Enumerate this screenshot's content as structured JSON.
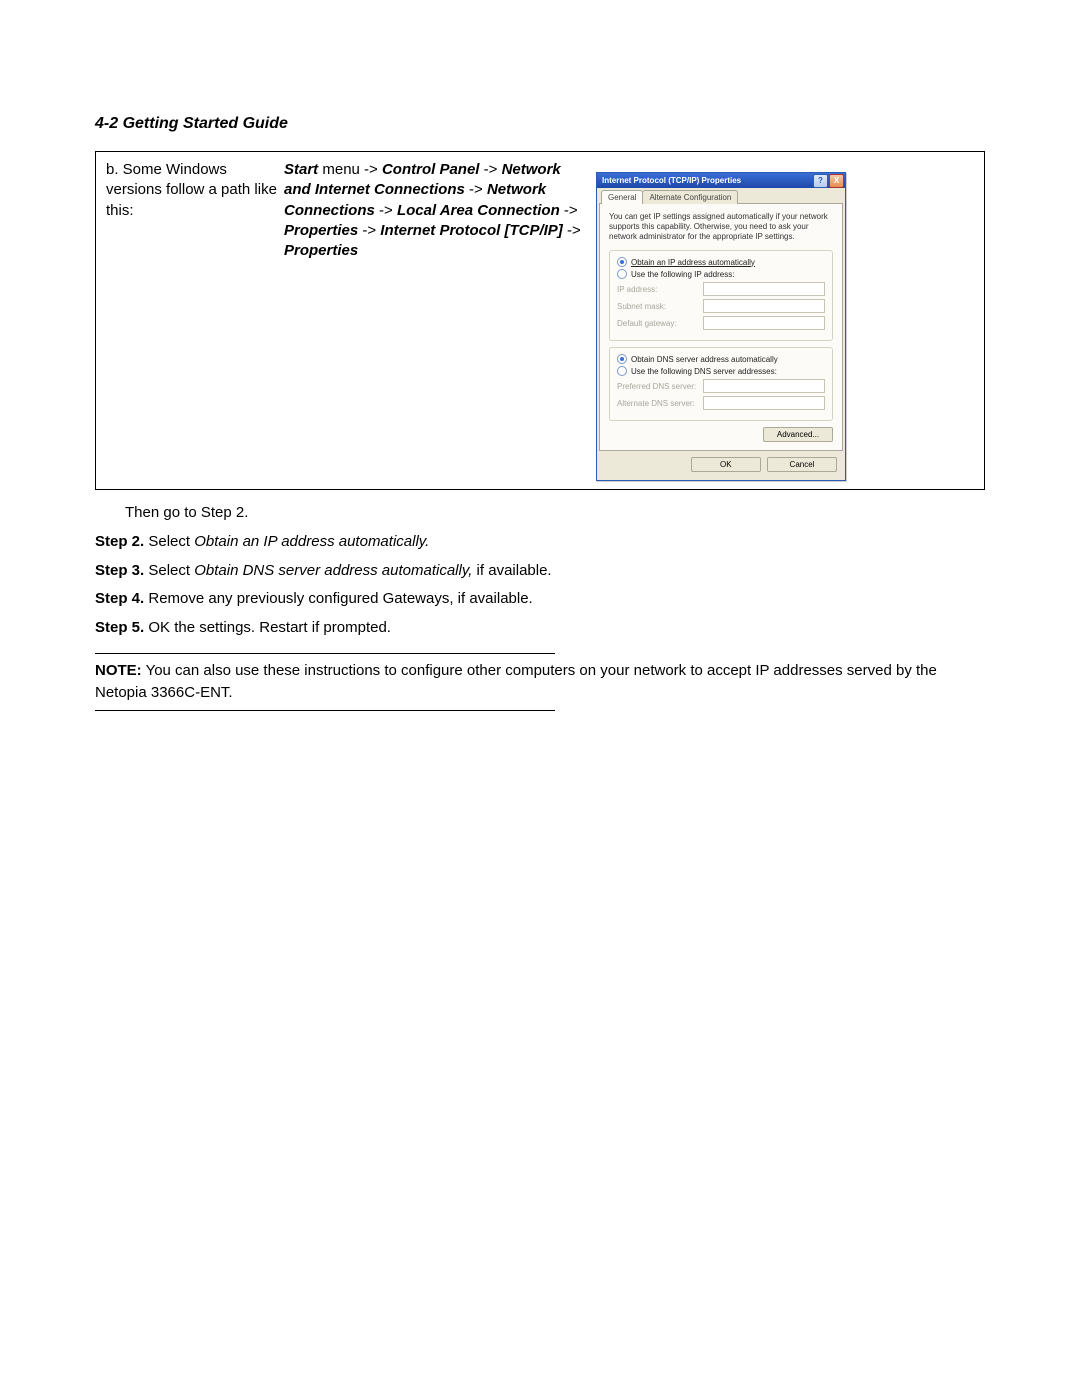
{
  "header": "4-2  Getting Started Guide",
  "box": {
    "left": "b. Some Windows versions follow a path like this:",
    "mid": {
      "p1a": "Start",
      "p1b": " menu -> ",
      "p1c": "Control Panel",
      "p1d": " -> ",
      "p1e": "Network and Internet Connections",
      "p1f": " -> ",
      "p1g": "Network Connections",
      "p1h": " -> ",
      "p1i": "Local Area Connection",
      "p1j": " -> ",
      "p1k": "Properties",
      "p1l": " -> ",
      "p1m": "Internet Protocol [TCP/IP]",
      "p1n": " -> ",
      "p1o": "Properties"
    }
  },
  "dialog": {
    "title": "Internet Protocol (TCP/IP) Properties",
    "help": "?",
    "close": "X",
    "tab_general": "General",
    "tab_alt": "Alternate Configuration",
    "hint": "You can get IP settings assigned automatically if your network supports this capability. Otherwise, you need to ask your network administrator for the appropriate IP settings.",
    "r_obtain_ip": "Obtain an IP address automatically",
    "r_use_ip": "Use the following IP address:",
    "lbl_ip": "IP address:",
    "lbl_subnet": "Subnet mask:",
    "lbl_gw": "Default gateway:",
    "r_obtain_dns": "Obtain DNS server address automatically",
    "r_use_dns": "Use the following DNS server addresses:",
    "lbl_pdns": "Preferred DNS server:",
    "lbl_adns": "Alternate DNS server:",
    "btn_adv": "Advanced...",
    "btn_ok": "OK",
    "btn_cancel": "Cancel"
  },
  "body": {
    "then": "Then go to Step 2.",
    "s2a": "Step 2.",
    "s2b": " Select ",
    "s2c": "Obtain an IP address automatically.",
    "s3a": "Step 3.",
    "s3b": " Select ",
    "s3c": "Obtain DNS server address automatically,",
    "s3d": " if available.",
    "s4a": "Step 4.",
    "s4b": " Remove any previously configured Gateways, if available.",
    "s5a": "Step 5.",
    "s5b": " OK the settings. Restart if prompted.",
    "note_a": "NOTE:",
    "note_b": "  You can also use these instructions to configure other computers on your network to accept IP addresses served by the Netopia 3366C-ENT."
  }
}
